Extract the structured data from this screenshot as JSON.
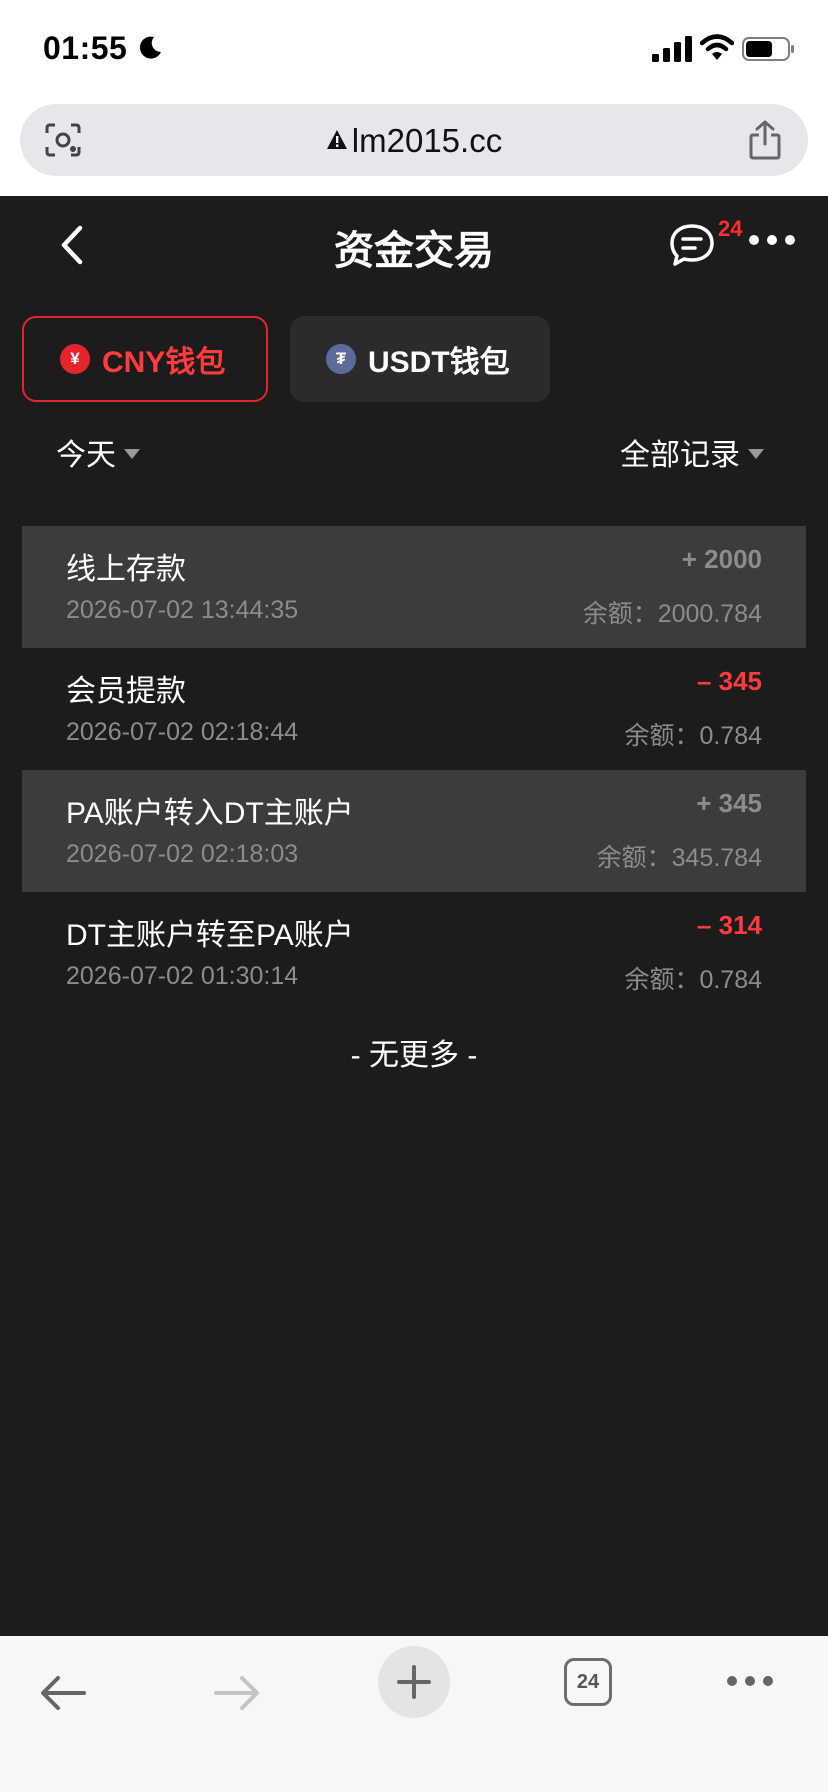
{
  "status_bar": {
    "time": "01:55"
  },
  "browser": {
    "url": "lm2015.cc",
    "tab_count": "24"
  },
  "header": {
    "title": "资金交易",
    "message_badge": "24"
  },
  "tabs": [
    {
      "label": "CNY钱包",
      "coin_symbol": "¥",
      "active": true
    },
    {
      "label": "USDT钱包",
      "coin_symbol": "₮",
      "active": false
    }
  ],
  "filters": {
    "date": "今天",
    "type": "全部记录"
  },
  "transactions": [
    {
      "title": "线上存款",
      "time": "2026-07-02 13:44:35",
      "amount": "+ 2000",
      "balance": "余额：2000.784"
    },
    {
      "title": "会员提款",
      "time": "2026-07-02 02:18:44",
      "amount": "– 345",
      "balance": "余额：0.784"
    },
    {
      "title": "PA账户转入DT主账户",
      "time": "2026-07-02 02:18:03",
      "amount": "+ 345",
      "balance": "余额：345.784"
    },
    {
      "title": "DT主账户转至PA账户",
      "time": "2026-07-02 01:30:14",
      "amount": "– 314",
      "balance": "余额：0.784"
    }
  ],
  "footer_text": "- 无更多 -",
  "colors": {
    "accent_red": "#ff3b3b",
    "background": "#1c1c1c",
    "highlight_row": "#3c3c3c"
  }
}
